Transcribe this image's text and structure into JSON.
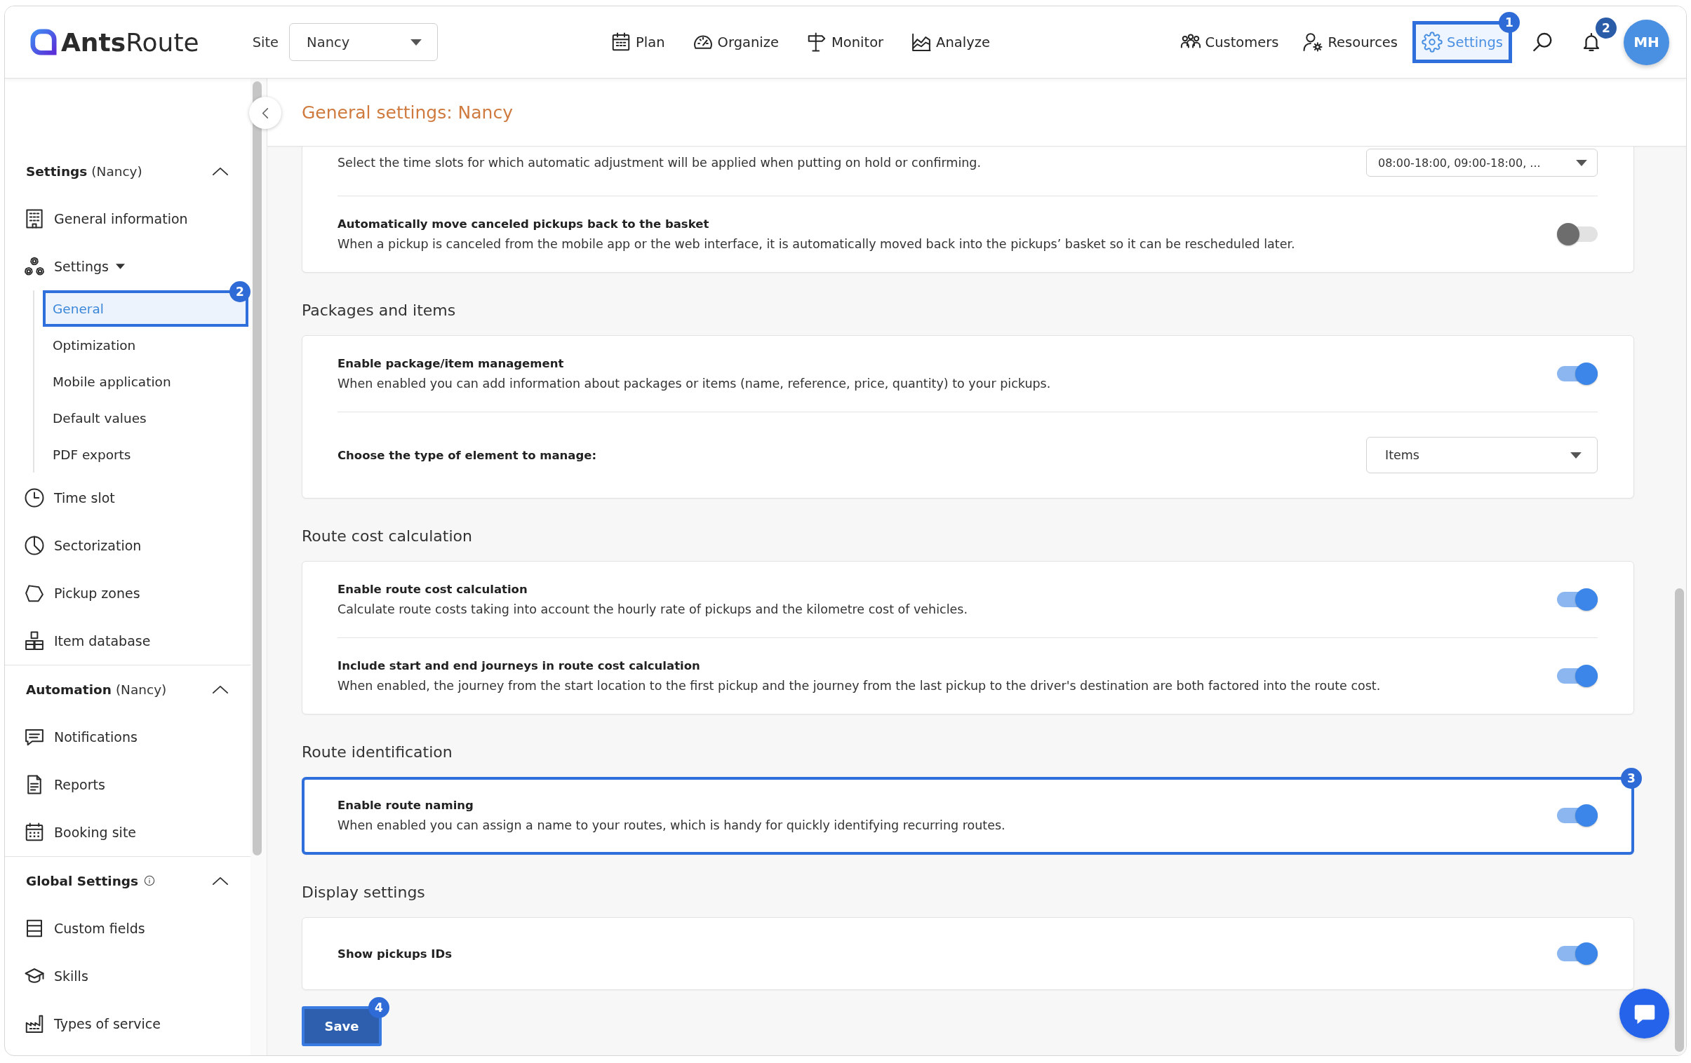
{
  "top_bar": {
    "logo": "**Ants**Route",
    "site": {
      "label": "Site",
      "value": "Nancy"
    },
    "main_nav": [
      {
        "label": "Plan",
        "selected": false
      },
      {
        "label": "Organize",
        "selected": false
      },
      {
        "label": "Monitor",
        "selected": false
      },
      {
        "label": "Analyze",
        "selected": false
      }
    ],
    "right_nav": [
      {
        "label": "Customers",
        "selected": false
      },
      {
        "label": "Resources",
        "selected": false
      },
      {
        "label": "Settings",
        "selected": true,
        "callout": "1"
      }
    ],
    "notifications": {
      "count": "2"
    },
    "avatar": {
      "initials": "MH"
    }
  },
  "sidebar": {
    "sections": [
      {
        "title": "Settings",
        "scope": "(Nancy)",
        "expanded": true,
        "items": [
          {
            "label": "General information",
            "selected": false
          },
          {
            "label": "Settings",
            "selected": false,
            "expanded": true,
            "children": [
              {
                "label": "General",
                "selected": true,
                "callout": "2"
              },
              {
                "label": "Optimization",
                "selected": false
              },
              {
                "label": "Mobile application",
                "selected": false
              },
              {
                "label": "Default values",
                "selected": false
              },
              {
                "label": "PDF exports",
                "selected": false
              }
            ]
          },
          {
            "label": "Time slot",
            "selected": false
          },
          {
            "label": "Sectorization",
            "selected": false
          },
          {
            "label": "Pickup zones",
            "selected": false
          },
          {
            "label": "Item database",
            "selected": false
          }
        ]
      },
      {
        "title": "Automation",
        "scope": "(Nancy)",
        "expanded": true,
        "items": [
          {
            "label": "Notifications",
            "selected": false
          },
          {
            "label": "Reports",
            "selected": false
          },
          {
            "label": "Booking site",
            "selected": false
          }
        ]
      },
      {
        "title": "Global Settings",
        "expanded": true,
        "items": [
          {
            "label": "Custom fields",
            "selected": false
          },
          {
            "label": "Skills",
            "selected": false
          },
          {
            "label": "Types of service",
            "selected": false
          }
        ]
      }
    ]
  },
  "page": {
    "title": "General settings: Nancy",
    "groups": [
      {
        "rows": [
          {
            "kind": "select",
            "description": "Select the time slots for which automatic adjustment will be applied when putting on hold or confirming.",
            "value": "08:00-18:00, 09:00-18:00, ..."
          },
          {
            "kind": "toggle",
            "title": "Automatically move canceled pickups back to the basket",
            "description": "When a pickup is canceled from the mobile app or the web interface, it is automatically moved back into the pickups’ basket so it can be rescheduled later.",
            "on": false
          }
        ]
      },
      {
        "title": "Packages and items",
        "rows": [
          {
            "kind": "toggle",
            "title": "Enable package/item management",
            "description": "When enabled you can add information about packages or items (name, reference, price, quantity) to your pickups.",
            "on": true
          },
          {
            "kind": "select",
            "title": "Choose the type of element to manage:",
            "value": "Items"
          }
        ]
      },
      {
        "title": "Route cost calculation",
        "rows": [
          {
            "kind": "toggle",
            "title": "Enable route cost calculation",
            "description": "Calculate route costs taking into account the hourly rate of pickups and the kilometre cost of vehicles.",
            "on": true
          },
          {
            "kind": "toggle",
            "title": "Include start and end journeys in route cost calculation",
            "description": "When enabled, the journey from the start location to the first pickup and the journey from the last pickup to the driver's destination are both factored into the route cost.",
            "on": true
          }
        ]
      },
      {
        "title": "Route identification",
        "callout": "3",
        "rows": [
          {
            "kind": "toggle",
            "title": "Enable route naming",
            "description": "When enabled you can assign a name to your routes, which is handy for quickly identifying recurring routes.",
            "on": true
          }
        ]
      },
      {
        "title": "Display settings",
        "rows": [
          {
            "kind": "toggle",
            "title": "Show pickups IDs",
            "on": true
          }
        ]
      }
    ],
    "save_button": {
      "label": "Save",
      "callout": "4"
    }
  }
}
